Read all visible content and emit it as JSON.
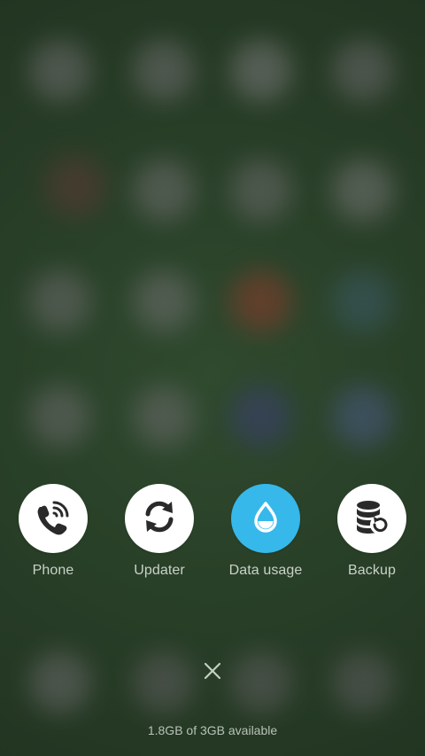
{
  "shortcuts": [
    {
      "label": "Phone",
      "icon": "phone-call-icon"
    },
    {
      "label": "Updater",
      "icon": "sync-arrows-icon"
    },
    {
      "label": "Data usage",
      "icon": "water-drop-icon"
    },
    {
      "label": "Backup",
      "icon": "database-restore-icon"
    }
  ],
  "close": {
    "icon": "close-icon"
  },
  "memory": {
    "text": "1.8GB of 3GB available"
  },
  "colors": {
    "background": "#2b3f2a",
    "icon_circle": "#ffffff",
    "accent_circle": "#36b8eb",
    "icon_glyph": "#2a2a2a"
  }
}
